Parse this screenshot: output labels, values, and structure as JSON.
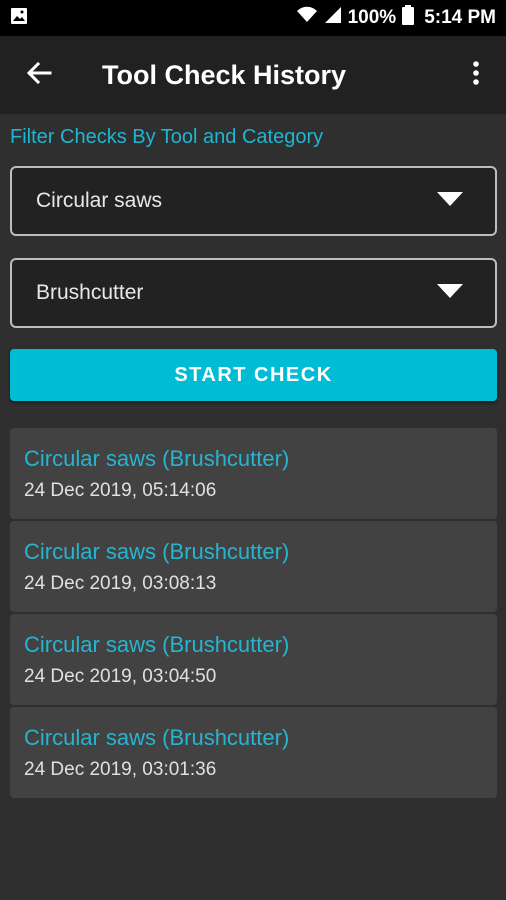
{
  "status_bar": {
    "battery_percent": "100%",
    "time": "5:14 PM",
    "icons": [
      "gallery-icon",
      "wifi-icon",
      "signal-icon",
      "battery-icon"
    ]
  },
  "app_bar": {
    "title": "Tool Check History",
    "back_icon": "arrow-back-icon",
    "menu_icon": "more-vert-icon"
  },
  "filter": {
    "label": "Filter Checks By Tool and Category",
    "tool_value": "Circular saws",
    "category_value": "Brushcutter"
  },
  "start_button": {
    "label": "START CHECK"
  },
  "history": [
    {
      "title": "Circular saws (Brushcutter)",
      "date": "24 Dec 2019, 05:14:06"
    },
    {
      "title": "Circular saws (Brushcutter)",
      "date": "24 Dec 2019, 03:08:13"
    },
    {
      "title": "Circular saws (Brushcutter)",
      "date": "24 Dec 2019, 03:04:50"
    },
    {
      "title": "Circular saws (Brushcutter)",
      "date": "24 Dec 2019, 03:01:36"
    }
  ],
  "colors": {
    "accent": "#00bcd4",
    "link_text": "#26b5d1",
    "background": "#2f2f2f",
    "app_bar": "#212121",
    "card": "#424242"
  }
}
